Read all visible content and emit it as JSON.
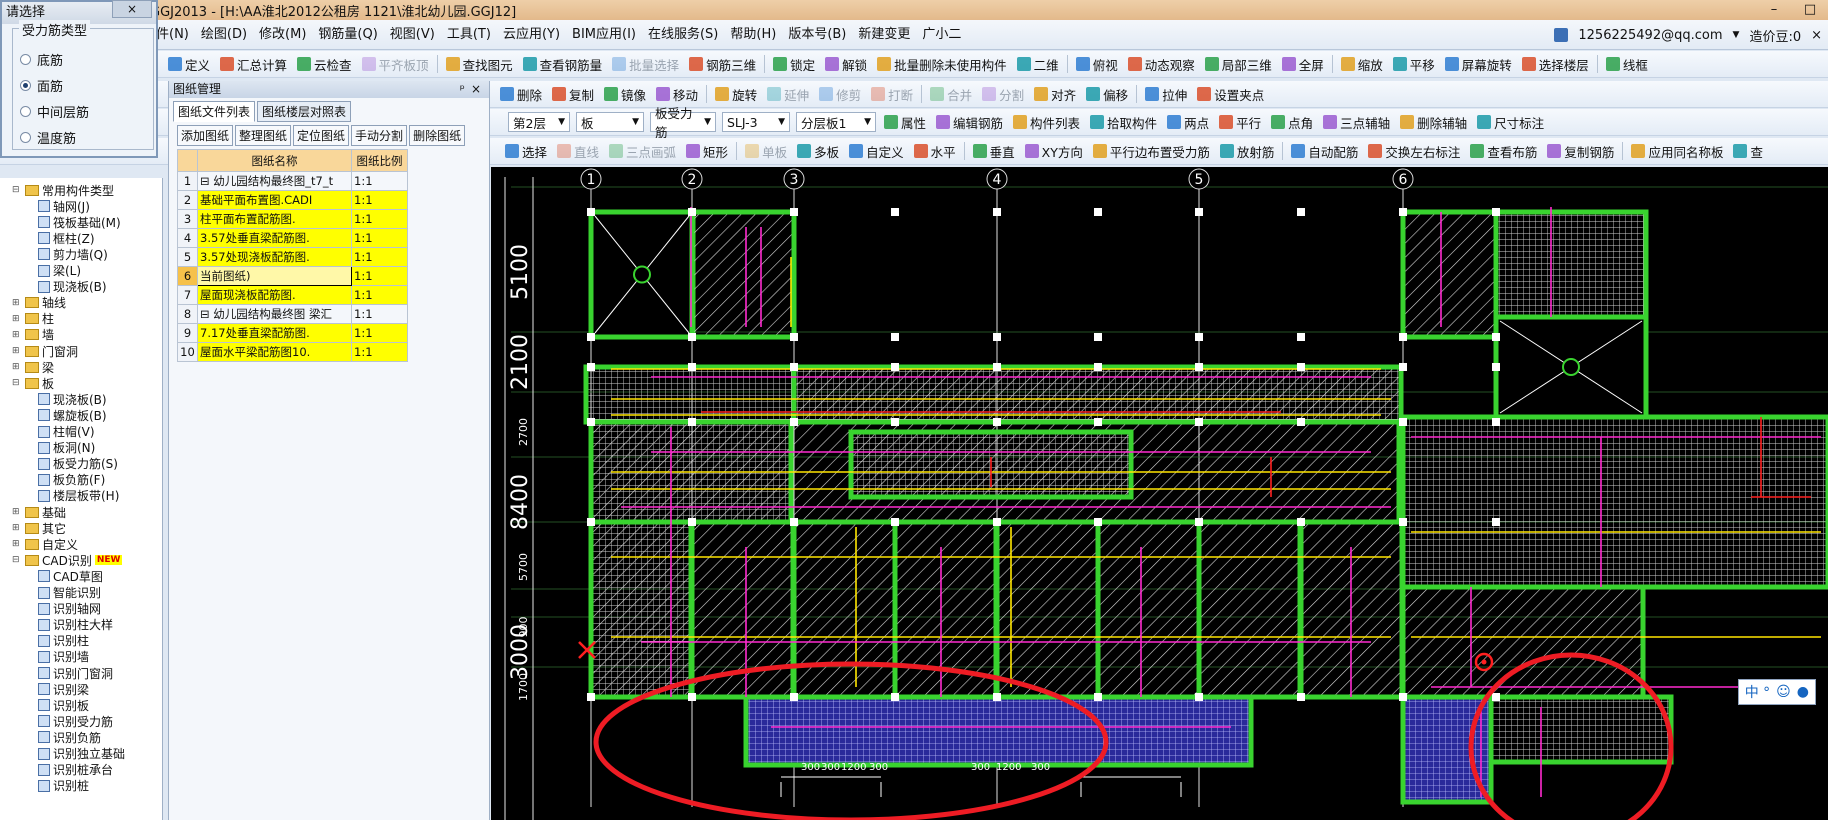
{
  "title": "GGJ2013 - [H:\\AA淮北2012公租房 1121\\淮北幼儿园.GGJ12]",
  "menu": [
    "件(N)",
    "绘图(D)",
    "修改(M)",
    "钢筋量(Q)",
    "视图(V)",
    "工具(T)",
    "云应用(Y)",
    "BIM应用(I)",
    "在线服务(S)",
    "帮助(H)",
    "版本号(B)",
    "新建变更",
    "广小二"
  ],
  "account": "1256225492@qq.com",
  "coins": "造价豆:0",
  "toolbar1": [
    "定义",
    "汇总计算",
    "云检查",
    "平齐板顶",
    "查找图元",
    "查看钢筋量",
    "批量选择",
    "钢筋三维",
    "锁定",
    "解锁",
    "批量删除未使用构件",
    "二维",
    "俯视",
    "动态观察",
    "局部三维",
    "全屏",
    "缩放",
    "平移",
    "屏幕旋转",
    "选择楼层",
    "线框"
  ],
  "toolbar2": [
    "删除",
    "复制",
    "镜像",
    "移动",
    "旋转",
    "延伸",
    "修剪",
    "打断",
    "合并",
    "分割",
    "对齐",
    "偏移",
    "拉伸",
    "设置夹点"
  ],
  "toolbar3": {
    "floor": "第2层",
    "type": "板",
    "sub": "板受力筋",
    "code": "SLJ-3",
    "layer": "分层板1",
    "items": [
      "属性",
      "编辑钢筋",
      "构件列表",
      "拾取构件",
      "两点",
      "平行",
      "点角",
      "三点辅轴",
      "删除辅轴",
      "尺寸标注"
    ]
  },
  "toolbar4": [
    "选择",
    "直线",
    "三点画弧",
    "矩形",
    "单板",
    "多板",
    "自定义",
    "水平",
    "垂直",
    "XY方向",
    "平行边布置受力筋",
    "放射筋",
    "自动配筋",
    "交换左右标注",
    "查看布筋",
    "复制钢筋",
    "应用同名称板",
    "查"
  ],
  "popup": {
    "title": "请选择",
    "close": "×",
    "group": "受力筋类型",
    "options": [
      "底筋",
      "面筋",
      "中间层筋",
      "温度筋"
    ],
    "selected": 1
  },
  "panel": {
    "title": "图纸管理",
    "pin": "ᵖ",
    "close": "×",
    "tabs": [
      "图纸文件列表",
      "图纸楼层对照表"
    ],
    "buttons": [
      "添加图纸",
      "整理图纸",
      "定位图纸",
      "手动分割",
      "删除图纸"
    ],
    "col_name": "图纸名称",
    "col_scale": "图纸比例",
    "rows": [
      {
        "n": "1",
        "name": "⊟ 幼儿园结构最终图_t7_t",
        "scale": "1:1",
        "y": false
      },
      {
        "n": "2",
        "name": "基础平面布置图.CADI",
        "scale": "1:1",
        "y": true
      },
      {
        "n": "3",
        "name": "柱平面布置配筋图.",
        "scale": "1:1",
        "y": true
      },
      {
        "n": "4",
        "name": "3.57处垂直梁配筋图.",
        "scale": "1:1",
        "y": true
      },
      {
        "n": "5",
        "name": "3.57处现浇板配筋图.",
        "scale": "1:1",
        "y": true
      },
      {
        "n": "6",
        "name": "当前图纸)",
        "scale": "1:1",
        "y": true
      },
      {
        "n": "7",
        "name": "屋面现浇板配筋图.",
        "scale": "1:1",
        "y": true
      },
      {
        "n": "8",
        "name": "⊟ 幼儿园结构最终图 梁汇",
        "scale": "1:1",
        "y": false
      },
      {
        "n": "9",
        "name": "7.17处垂直梁配筋图.",
        "scale": "1:1",
        "y": true
      },
      {
        "n": "10",
        "name": "屋面水平梁配筋图10.",
        "scale": "1:1",
        "y": true
      }
    ]
  },
  "tree": [
    {
      "label": "常用构件类型",
      "lvl": 0,
      "kind": "fold",
      "ex": "⊟"
    },
    {
      "label": "轴网(J)",
      "lvl": 1,
      "kind": "ico"
    },
    {
      "label": "筏板基础(M)",
      "lvl": 1,
      "kind": "ico"
    },
    {
      "label": "框柱(Z)",
      "lvl": 1,
      "kind": "ico"
    },
    {
      "label": "剪力墙(Q)",
      "lvl": 1,
      "kind": "ico"
    },
    {
      "label": "梁(L)",
      "lvl": 1,
      "kind": "ico"
    },
    {
      "label": "现浇板(B)",
      "lvl": 1,
      "kind": "ico"
    },
    {
      "label": "轴线",
      "lvl": 0,
      "kind": "fold",
      "ex": "⊞"
    },
    {
      "label": "柱",
      "lvl": 0,
      "kind": "fold",
      "ex": "⊞"
    },
    {
      "label": "墙",
      "lvl": 0,
      "kind": "fold",
      "ex": "⊞"
    },
    {
      "label": "门窗洞",
      "lvl": 0,
      "kind": "fold",
      "ex": "⊞"
    },
    {
      "label": "梁",
      "lvl": 0,
      "kind": "fold",
      "ex": "⊞"
    },
    {
      "label": "板",
      "lvl": 0,
      "kind": "fold",
      "ex": "⊟"
    },
    {
      "label": "现浇板(B)",
      "lvl": 1,
      "kind": "ico"
    },
    {
      "label": "螺旋板(B)",
      "lvl": 1,
      "kind": "ico"
    },
    {
      "label": "柱帽(V)",
      "lvl": 1,
      "kind": "ico"
    },
    {
      "label": "板洞(N)",
      "lvl": 1,
      "kind": "ico"
    },
    {
      "label": "板受力筋(S)",
      "lvl": 1,
      "kind": "ico"
    },
    {
      "label": "板负筋(F)",
      "lvl": 1,
      "kind": "ico"
    },
    {
      "label": "楼层板带(H)",
      "lvl": 1,
      "kind": "ico"
    },
    {
      "label": "基础",
      "lvl": 0,
      "kind": "fold",
      "ex": "⊞"
    },
    {
      "label": "其它",
      "lvl": 0,
      "kind": "fold",
      "ex": "⊞"
    },
    {
      "label": "自定义",
      "lvl": 0,
      "kind": "fold",
      "ex": "⊞"
    },
    {
      "label": "CAD识别",
      "lvl": 0,
      "kind": "fold",
      "ex": "⊟",
      "badge": "NEW"
    },
    {
      "label": "CAD草图",
      "lvl": 1,
      "kind": "ico"
    },
    {
      "label": "智能识别",
      "lvl": 1,
      "kind": "ico"
    },
    {
      "label": "识别轴网",
      "lvl": 1,
      "kind": "ico"
    },
    {
      "label": "识别柱大样",
      "lvl": 1,
      "kind": "ico"
    },
    {
      "label": "识别柱",
      "lvl": 1,
      "kind": "ico"
    },
    {
      "label": "识别墙",
      "lvl": 1,
      "kind": "ico"
    },
    {
      "label": "识别门窗洞",
      "lvl": 1,
      "kind": "ico"
    },
    {
      "label": "识别梁",
      "lvl": 1,
      "kind": "ico"
    },
    {
      "label": "识别板",
      "lvl": 1,
      "kind": "ico"
    },
    {
      "label": "识别受力筋",
      "lvl": 1,
      "kind": "ico"
    },
    {
      "label": "识别负筋",
      "lvl": 1,
      "kind": "ico"
    },
    {
      "label": "识别独立基础",
      "lvl": 1,
      "kind": "ico"
    },
    {
      "label": "识别桩承台",
      "lvl": 1,
      "kind": "ico"
    },
    {
      "label": "识别桩",
      "lvl": 1,
      "kind": "ico"
    }
  ],
  "cad": {
    "axes": [
      "1",
      "2",
      "3",
      "4",
      "5",
      "6"
    ],
    "dims_left": [
      "5100",
      "2100",
      "2700",
      "8400",
      "5700",
      "900",
      "3000",
      "1700"
    ],
    "dims_bottom": [
      "300",
      "300",
      "1200",
      "300",
      "300",
      "1200",
      "300"
    ],
    "ime": "中 °"
  }
}
